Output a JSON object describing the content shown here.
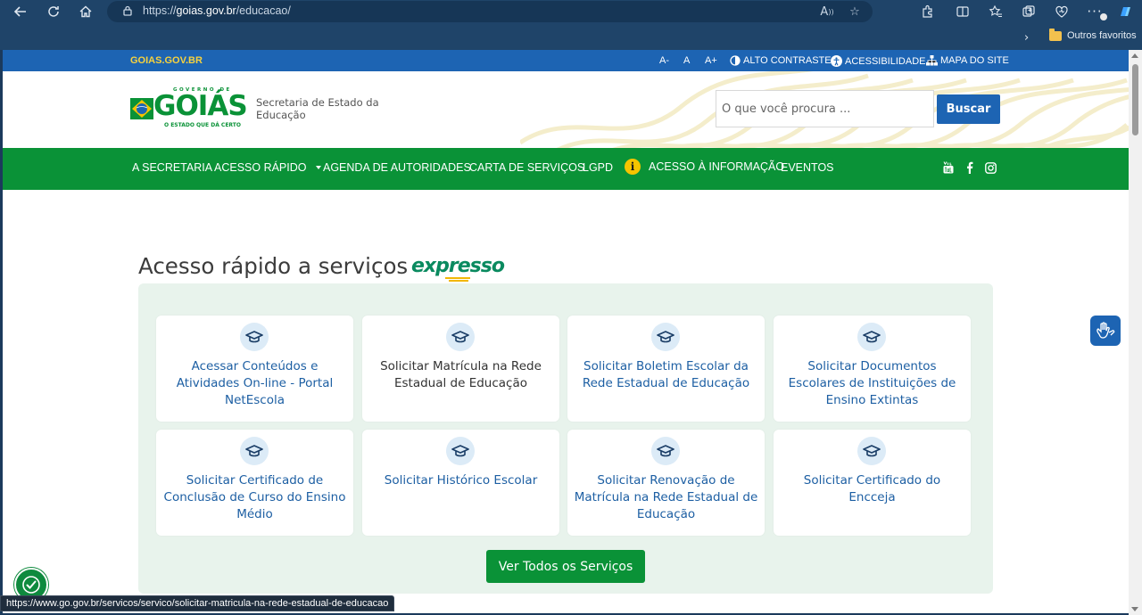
{
  "browser": {
    "url_prefix": "https://",
    "url_host": "goias.gov.br",
    "url_path": "/educacao/",
    "favorites_folder": "Outros favoritos",
    "status_url": "https://www.go.gov.br/servicos/servico/solicitar-matricula-na-rede-estadual-de-educacao"
  },
  "gov_bar": {
    "site": "GOIAS.GOV.BR",
    "font_decrease": "A-",
    "font_normal": "A",
    "font_increase": "A+",
    "high_contrast": "ALTO CONTRASTE",
    "accessibility": "ACESSIBILIDADE",
    "sitemap": "MAPA DO SITE"
  },
  "header": {
    "logo_top": "GOVERNO DE",
    "logo_main": "GOIÁS",
    "logo_tagline": "O ESTADO QUE DÁ CERTO",
    "secretaria": "Secretaria de Estado da Educação",
    "search_placeholder": "O que você procura ...",
    "search_button": "Buscar"
  },
  "nav": {
    "items": [
      "A SECRETARIA",
      "ACESSO RÁPIDO",
      "AGENDA DE AUTORIDADES",
      "CARTA DE SERVIÇOS",
      "LGPD",
      "ACESSO À INFORMAÇÃO",
      "EVENTOS"
    ],
    "info_icon_letter": "i"
  },
  "quick_access": {
    "title": "Acesso rápido a serviços",
    "brand": "expresso",
    "cards": [
      "Acessar Conteúdos e Atividades On-line - Portal NetEscola",
      "Solicitar Matrícula na Rede Estadual de Educação",
      "Solicitar Boletim Escolar da Rede Estadual de Educação",
      "Solicitar Documentos Escolares de Instituições de Ensino Extintas",
      "Solicitar Certificado de Conclusão de Curso do Ensino Médio",
      "Solicitar Histórico Escolar",
      "Solicitar Renovação de Matrícula na Rede Estadual de Educação",
      "Solicitar Certificado do Encceja"
    ],
    "cta": "Ver Todos os Serviços"
  },
  "colors": {
    "gov_blue": "#1d64b3",
    "nav_green": "#0a9237",
    "link_blue": "#1d5fa3",
    "panel_bg": "#e8f3ec"
  }
}
